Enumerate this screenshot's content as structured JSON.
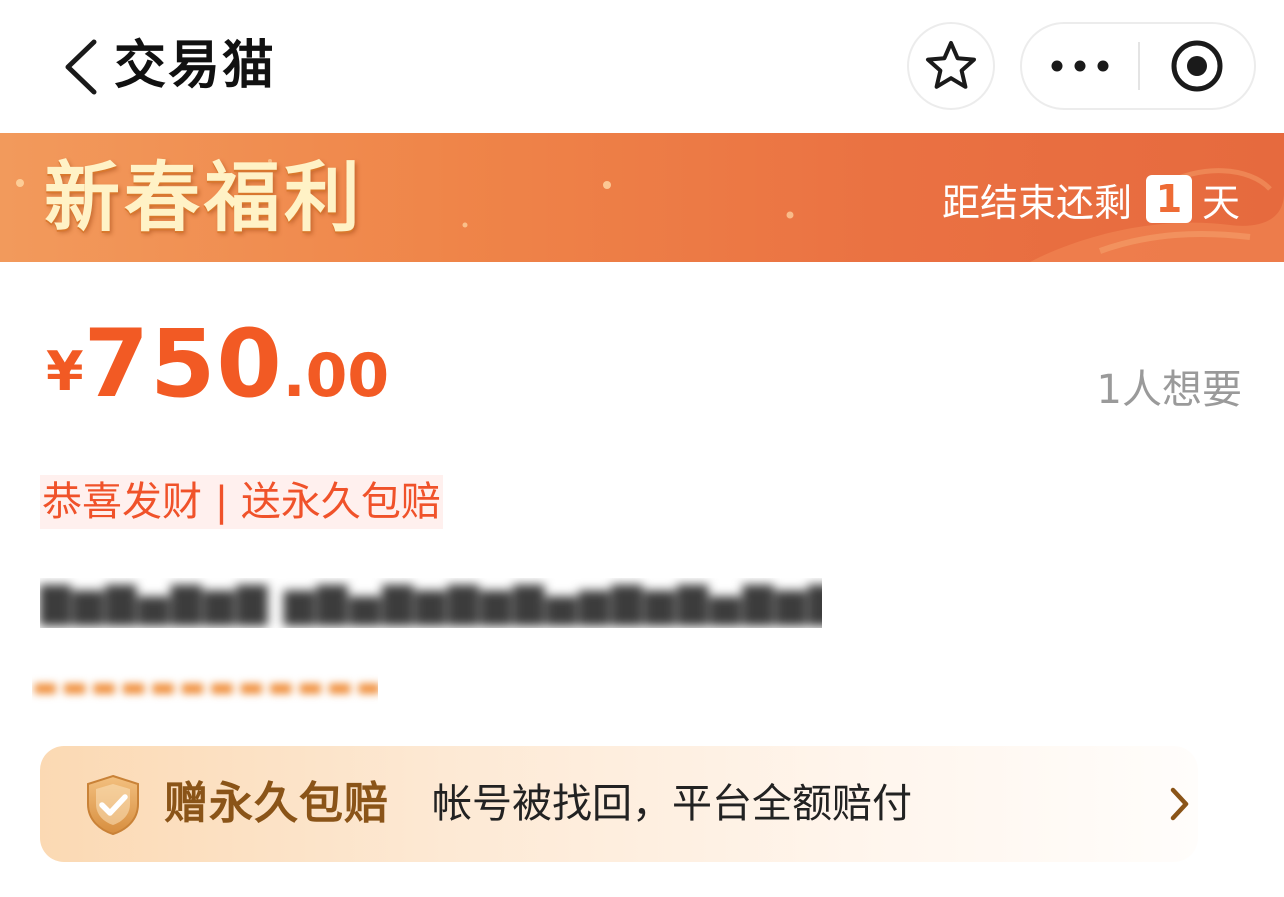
{
  "header": {
    "app_title": "交易猫",
    "back_icon": "chevron-left-icon",
    "favorite_icon": "star-outline-icon",
    "more_icon": "more-dots-icon",
    "close_icon": "target-circle-icon"
  },
  "banner": {
    "title": "新春福利",
    "countdown_prefix": "距结束还剩",
    "countdown_days": "1",
    "countdown_suffix": "天"
  },
  "price": {
    "currency": "¥",
    "integer": "750",
    "decimal": ".00",
    "want_count_text": "1人想要"
  },
  "tag": {
    "text": "恭喜发财 | 送永久包赔"
  },
  "guarantee": {
    "title": "赠永久包赔",
    "description": "帐号被找回，平台全额赔付"
  },
  "colors": {
    "price_accent": "#f25a24",
    "banner_start": "#f29a5c",
    "banner_end": "#e66a3e",
    "banner_title": "#fff2c6",
    "guarantee_title": "#8a5418"
  }
}
